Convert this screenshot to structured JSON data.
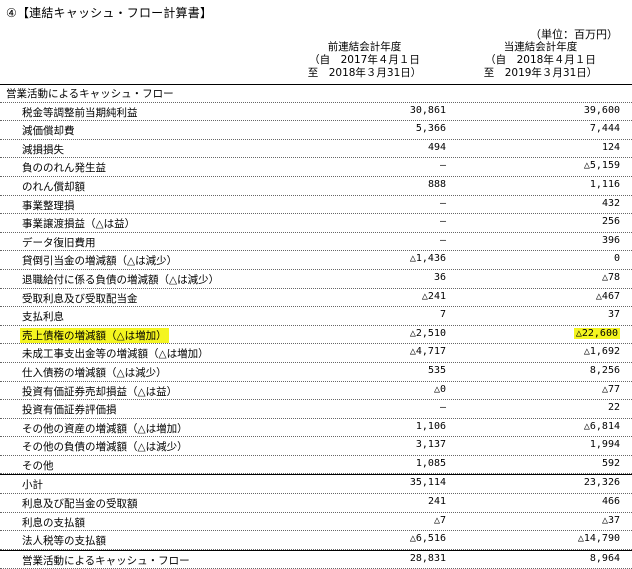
{
  "title": "④【連結キャッシュ・フロー計算書】",
  "unit": "（単位：百万円）",
  "columns": [
    {
      "line1": "前連結会計年度",
      "line2": "（自　2017年４月１日",
      "line3": "至　2018年３月31日）"
    },
    {
      "line1": "当連結会計年度",
      "line2": "（自　2018年４月１日",
      "line3": "至　2019年３月31日）"
    }
  ],
  "rows": [
    {
      "label": "営業活動によるキャッシュ・フロー",
      "v1": "",
      "v2": ""
    },
    {
      "label": "税金等調整前当期純利益",
      "v1": "30,861",
      "v2": "39,600"
    },
    {
      "label": "減価償却費",
      "v1": "5,366",
      "v2": "7,444"
    },
    {
      "label": "減損損失",
      "v1": "494",
      "v2": "124"
    },
    {
      "label": "負ののれん発生益",
      "v1": "―",
      "v2": "△5,159"
    },
    {
      "label": "のれん償却額",
      "v1": "888",
      "v2": "1,116"
    },
    {
      "label": "事業整理損",
      "v1": "―",
      "v2": "432"
    },
    {
      "label": "事業譲渡損益（△は益）",
      "v1": "―",
      "v2": "256"
    },
    {
      "label": "データ復旧費用",
      "v1": "―",
      "v2": "396"
    },
    {
      "label": "貸倒引当金の増減額（△は減少）",
      "v1": "△1,436",
      "v2": "0"
    },
    {
      "label": "退職給付に係る負債の増減額（△は減少）",
      "v1": "36",
      "v2": "△78"
    },
    {
      "label": "受取利息及び受取配当金",
      "v1": "△241",
      "v2": "△467"
    },
    {
      "label": "支払利息",
      "v1": "7",
      "v2": "37"
    },
    {
      "label": "売上債権の増減額（△は増加）",
      "v1": "△2,510",
      "v2": "△22,600"
    },
    {
      "label": "未成工事支出金等の増減額（△は増加）",
      "v1": "△4,717",
      "v2": "△1,692"
    },
    {
      "label": "仕入債務の増減額（△は減少）",
      "v1": "535",
      "v2": "8,256"
    },
    {
      "label": "投資有価証券売却損益（△は益）",
      "v1": "△0",
      "v2": "△77"
    },
    {
      "label": "投資有価証券評価損",
      "v1": "―",
      "v2": "22"
    },
    {
      "label": "その他の資産の増減額（△は増加）",
      "v1": "1,106",
      "v2": "△6,814"
    },
    {
      "label": "その他の負債の増減額（△は減少）",
      "v1": "3,137",
      "v2": "1,994"
    },
    {
      "label": "その他",
      "v1": "1,085",
      "v2": "592"
    },
    {
      "label": "小計",
      "v1": "35,114",
      "v2": "23,326"
    },
    {
      "label": "利息及び配当金の受取額",
      "v1": "241",
      "v2": "466"
    },
    {
      "label": "利息の支払額",
      "v1": "△7",
      "v2": "△37"
    },
    {
      "label": "法人税等の支払額",
      "v1": "△6,516",
      "v2": "△14,790"
    },
    {
      "label": "営業活動によるキャッシュ・フロー",
      "v1": "28,831",
      "v2": "8,964"
    }
  ]
}
